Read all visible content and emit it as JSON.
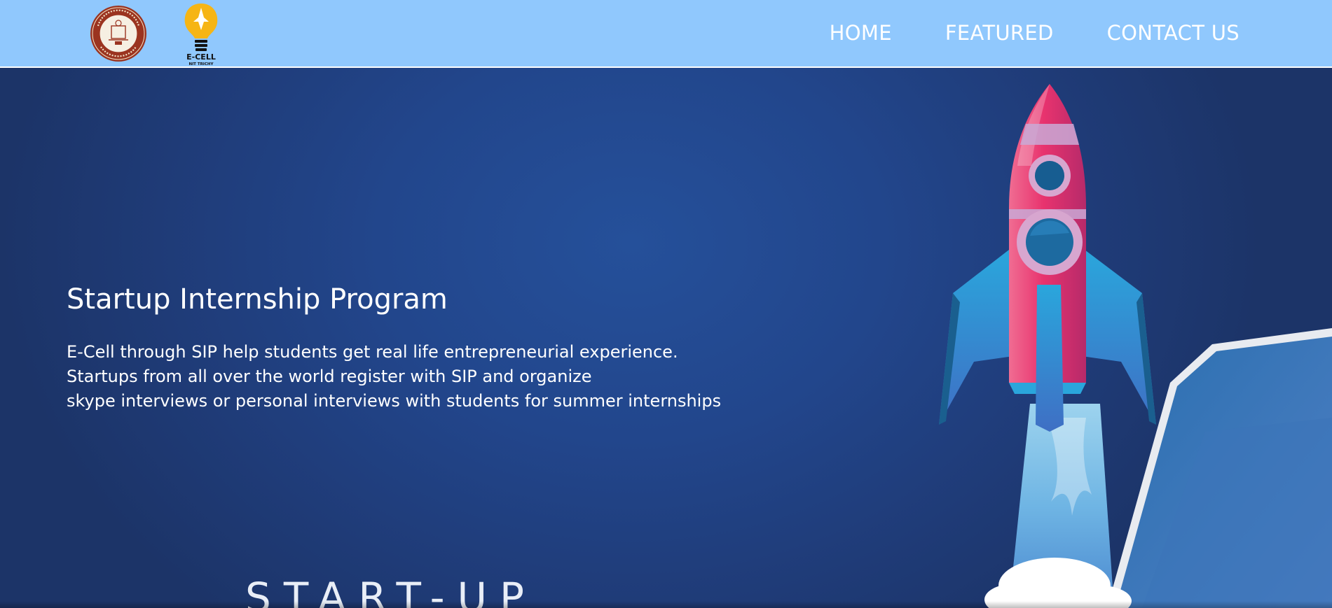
{
  "nav": {
    "items": [
      {
        "label": "HOME"
      },
      {
        "label": "FEATURED"
      },
      {
        "label": "CONTACT US"
      }
    ],
    "ecell_logo_text": "E-CELL",
    "ecell_logo_subtext": "NIT TRICHY"
  },
  "hero": {
    "title": "Startup Internship Program",
    "description_lines": [
      "E-Cell through SIP help students get real life entrepreneurial experience.",
      "Startups from all over the world register with SIP and organize",
      "skype interviews or personal interviews with students for summer internships"
    ],
    "startup_word": "START-UP"
  },
  "icons": {
    "nitt_logo": "nitt-emblem-icon",
    "ecell_logo": "lightbulb-rocket-icon",
    "rocket": "rocket-illustration-icon"
  },
  "colors": {
    "navbar": "#90c8fd",
    "hero_bg": "#22468c",
    "rocket_body": "#e8336e",
    "fin": "#2d9ad2"
  }
}
